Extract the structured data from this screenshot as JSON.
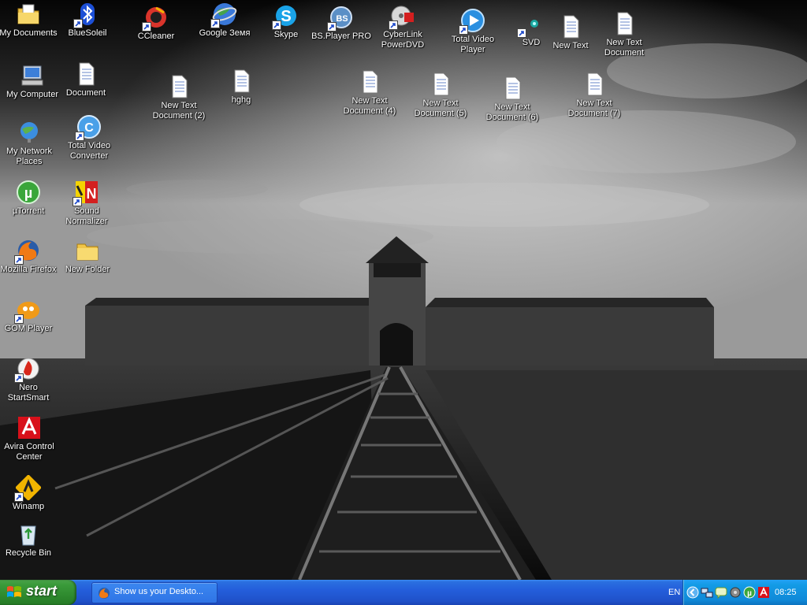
{
  "desktop": {
    "icons": {
      "my_documents": "My Documents",
      "bluesoleil": "BlueSoleil",
      "ccleaner": "CCleaner",
      "google_earth": "Google Земя",
      "skype": "Skype",
      "bsplayer": "BS.Player PRO",
      "cyberlink_line1": "CyberLink",
      "cyberlink_line2": "PowerDVD",
      "tvp_line1": "Total Video",
      "tvp_line2": "Player",
      "svd": "SVD",
      "new_text": "New Text",
      "ntd_line1": "New Text",
      "ntd_line2": "Document",
      "my_computer": "My Computer",
      "document": "Document",
      "ntd2_line1": "New Text",
      "ntd2_line2": "Document (2)",
      "hghg": "hghg",
      "ntd4_line1": "New Text",
      "ntd4_line2": "Document (4)",
      "ntd5_line1": "New Text",
      "ntd5_line2": "Document (5)",
      "ntd6_line1": "New Text",
      "ntd6_line2": "Document (6)",
      "ntd7_line1": "New Text",
      "ntd7_line2": "Document (7)",
      "network_line1": "My Network",
      "network_line2": "Places",
      "tvc_line1": "Total Video",
      "tvc_line2": "Converter",
      "utorrent": "µTorrent",
      "sound_line1": "Sound",
      "sound_line2": "Normalizer",
      "firefox": "Mozilla Firefox",
      "new_folder": "New Folder",
      "gom": "GOM Player",
      "nero_line1": "Nero",
      "nero_line2": "StartSmart",
      "avira_line1": "Avira Control",
      "avira_line2": "Center",
      "winamp": "Winamp",
      "recycle_bin": "Recycle Bin"
    }
  },
  "taskbar": {
    "start_label": "start",
    "task_item": "Show us your Deskto...",
    "language": "EN",
    "clock": "08:25"
  },
  "colors": {
    "taskbar_blue": "#245edb",
    "start_green": "#3a9a3a",
    "tray_blue": "#139be6"
  }
}
